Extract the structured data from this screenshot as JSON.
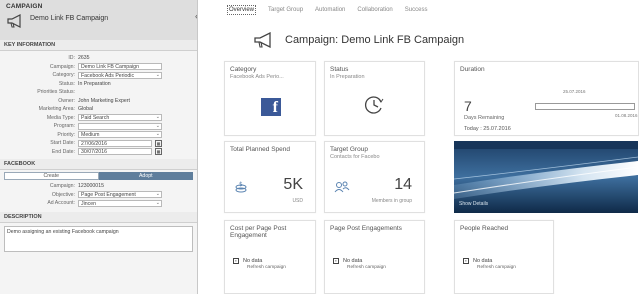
{
  "left": {
    "section_title": "CAMPAIGN",
    "campaign_name": "Demo Link FB Campaign",
    "collapse_icon": "chevron-left-icon",
    "key_info": {
      "heading": "KEY INFORMATION",
      "fields": [
        {
          "label": "ID:",
          "value": "2635",
          "type": "text"
        },
        {
          "label": "Campaign:",
          "value": "Demo Link FB Campaign",
          "type": "input"
        },
        {
          "label": "Category:",
          "value": "Facebook Ads Periodic",
          "type": "select"
        },
        {
          "label": "Status:",
          "value": "In Preparation",
          "type": "text"
        },
        {
          "label": "Priorities Status:",
          "value": "",
          "type": "text"
        },
        {
          "label": "Owner:",
          "value": "John Marketing Expert",
          "type": "text"
        },
        {
          "label": "Marketing Area:",
          "value": "Global",
          "type": "text"
        },
        {
          "label": "Media Type:",
          "value": "Paid Search",
          "type": "select"
        },
        {
          "label": "Program:",
          "value": "",
          "type": "select"
        },
        {
          "label": "Priority:",
          "value": "Medium",
          "type": "select"
        }
      ],
      "start_date": {
        "label": "Start Date:",
        "value": "27/06/2016"
      },
      "end_date": {
        "label": "End Date:",
        "value": "30/07/2016"
      }
    },
    "facebook": {
      "heading": "FACEBOOK",
      "tabs": [
        "Create",
        "Adopt"
      ],
      "active_tab": 1,
      "fields": [
        {
          "label": "Campaign:",
          "value": "123000015",
          "type": "text"
        },
        {
          "label": "Objective:",
          "value": "Page Post Engagement",
          "type": "select"
        },
        {
          "label": "Ad Account:",
          "value": "Jincen",
          "type": "select"
        }
      ]
    },
    "description": {
      "heading": "DESCRIPTION",
      "text": "Demo assigning an existing Facebook campaign"
    }
  },
  "right": {
    "nav": [
      "Overview",
      "Target Group",
      "Automation",
      "Collaboration",
      "Success"
    ],
    "active_nav": 0,
    "title": "Campaign: Demo Link FB Campaign",
    "category_tile": {
      "title": "Category",
      "sub": "Facebook Ads Perio...",
      "logo_letter": "f"
    },
    "status_tile": {
      "title": "Status",
      "sub": "In Preparation"
    },
    "duration_tile": {
      "title": "Duration",
      "value": "7",
      "label": "Days Remaining",
      "today": "Today : 25.07.2016",
      "start": "25.07.2016",
      "end": "01.08.2016",
      "progress": 0.0
    },
    "spend_tile": {
      "title": "Total Planned Spend",
      "value": "5K",
      "unit": "USD"
    },
    "target_tile": {
      "title": "Target Group",
      "sub": "Contacts for Facebo",
      "value": "14",
      "unit": "Members in group"
    },
    "image_tile": {
      "link": "Show Details"
    },
    "cost_tile": {
      "title": "Cost per Page Post Engagement",
      "nodata": "No data",
      "sub": "Refresh campaign"
    },
    "engage_tile": {
      "title": "Page Post Engagements",
      "nodata": "No data",
      "sub": "Refresh campaign"
    },
    "reach_tile": {
      "title": "People Reached",
      "nodata": "No data",
      "sub": "Refresh campaign"
    }
  },
  "colors": {
    "facebook_blue": "#3b5998",
    "tab_active": "#5f7e9c",
    "panel_bg": "#f4f4f4"
  }
}
